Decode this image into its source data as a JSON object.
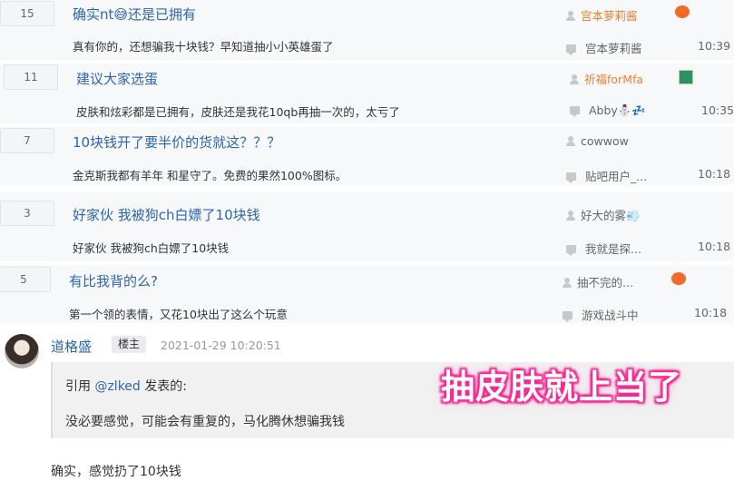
{
  "threads": [
    {
      "count": "15",
      "title": "确实nt😅还是已拥有",
      "author": "宫本萝莉酱",
      "preview": "真有你的，还想骗我十块钱？早知道抽小小英雄蛋了",
      "last_user": "宫本萝莉酱",
      "time": "10:39"
    },
    {
      "count": "11",
      "title": "建议大家选蛋",
      "author": "祈福forMfa",
      "preview": "皮肤和炫彩都是已拥有，皮肤还是我花10qb再抽一次的，太亏了",
      "last_user": "Abby⛄💤",
      "time": "10:35"
    },
    {
      "count": "7",
      "title": "10块钱开了要半价的货就这？？？",
      "author": "cowwow",
      "preview": "金克斯我都有羊年 和星守了。免费的果然100%图标。",
      "last_user": "贴吧用户_...",
      "time": "10:18"
    },
    {
      "count": "3",
      "title": "好家伙 我被狗ch白嫖了10块钱",
      "author": "好大的雾💨",
      "preview": "好家伙 我被狗ch白嫖了10块钱",
      "last_user": "我就是探...",
      "time": "10:18"
    },
    {
      "count": "5",
      "title": "有比我背的么?",
      "author": "抽不完的...",
      "preview": "第一个领的表情，又花10块出了这么个玩意",
      "last_user": "游戏战斗中",
      "time": "10:18"
    }
  ],
  "post": {
    "author": "道格盛",
    "badge": "楼主",
    "date": "2021-01-29 10:20:51",
    "quote_prefix": "引用 ",
    "quote_user": "@zlked",
    "quote_suffix": " 发表的:",
    "quote_text": "没必要感觉，可能会有重复的，马化腾休想骗我钱",
    "reply": "确实，感觉扔了10块钱"
  },
  "overlay_caption": "抽皮肤就上当了",
  "colors": {
    "link": "#2d64b3",
    "vip": "#f08033",
    "row_bg": "#f7f8fa"
  },
  "icons": {
    "user": "user-icon",
    "comment": "comment-icon"
  }
}
